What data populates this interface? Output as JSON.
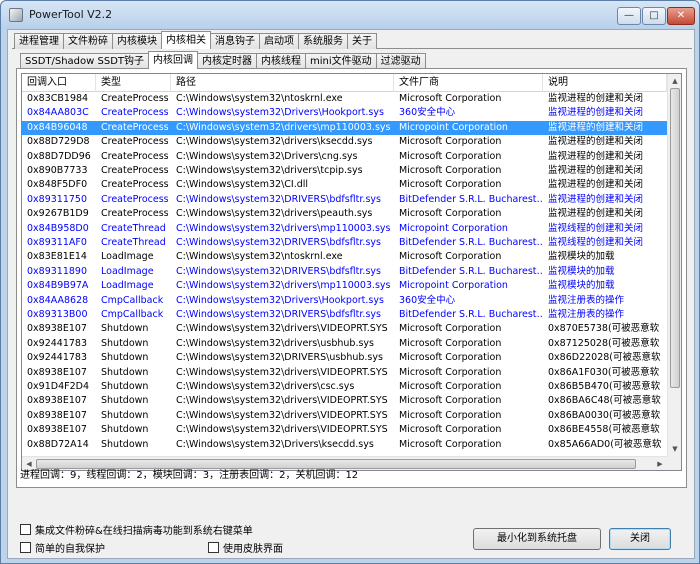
{
  "window": {
    "title": "PowerTool V2.2"
  },
  "tabs_top": [
    "进程管理",
    "文件粉碎",
    "内核模块",
    "内核相关",
    "消息钩子",
    "启动项",
    "系统服务",
    "关于"
  ],
  "tabs_top_active": 3,
  "tabs_sub": [
    "SSDT/Shadow SSDT钩子",
    "内核回调",
    "内核定时器",
    "内核线程",
    "mini文件驱动",
    "过滤驱动"
  ],
  "tabs_sub_active": 1,
  "columns": [
    "回调入口",
    "类型",
    "路径",
    "文件厂商",
    "说明"
  ],
  "rows": [
    {
      "entry": "0x83CB1984",
      "type": "CreateProcess",
      "path": "C:\\Windows\\system32\\ntoskrnl.exe",
      "vendor": "Microsoft Corporation",
      "desc": "监视进程的创建和关闭",
      "blue": false
    },
    {
      "entry": "0x84AA803C",
      "type": "CreateProcess",
      "path": "C:\\Windows\\system32\\Drivers\\Hookport.sys",
      "vendor": "360安全中心",
      "desc": "监视进程的创建和关闭",
      "blue": true
    },
    {
      "entry": "0x84B96048",
      "type": "CreateProcess",
      "path": "C:\\Windows\\system32\\drivers\\mp110003.sys",
      "vendor": "Micropoint Corporation",
      "desc": "监视进程的创建和关闭",
      "blue": true,
      "selected": true
    },
    {
      "entry": "0x88D729D8",
      "type": "CreateProcess",
      "path": "C:\\Windows\\system32\\drivers\\ksecdd.sys",
      "vendor": "Microsoft Corporation",
      "desc": "监视进程的创建和关闭",
      "blue": false
    },
    {
      "entry": "0x88D7DD96",
      "type": "CreateProcess",
      "path": "C:\\Windows\\system32\\Drivers\\cng.sys",
      "vendor": "Microsoft Corporation",
      "desc": "监视进程的创建和关闭",
      "blue": false
    },
    {
      "entry": "0x890B7733",
      "type": "CreateProcess",
      "path": "C:\\Windows\\system32\\drivers\\tcpip.sys",
      "vendor": "Microsoft Corporation",
      "desc": "监视进程的创建和关闭",
      "blue": false
    },
    {
      "entry": "0x848F5DF0",
      "type": "CreateProcess",
      "path": "C:\\Windows\\system32\\CI.dll",
      "vendor": "Microsoft Corporation",
      "desc": "监视进程的创建和关闭",
      "blue": false
    },
    {
      "entry": "0x89311750",
      "type": "CreateProcess",
      "path": "C:\\Windows\\system32\\DRIVERS\\bdfsfltr.sys",
      "vendor": "BitDefender S.R.L. Bucharest…",
      "desc": "监视进程的创建和关闭",
      "blue": true
    },
    {
      "entry": "0x9267B1D9",
      "type": "CreateProcess",
      "path": "C:\\Windows\\system32\\drivers\\peauth.sys",
      "vendor": "Microsoft Corporation",
      "desc": "监视进程的创建和关闭",
      "blue": false
    },
    {
      "entry": "0x84B958D0",
      "type": "CreateThread",
      "path": "C:\\Windows\\system32\\drivers\\mp110003.sys",
      "vendor": "Micropoint Corporation",
      "desc": "监视线程的创建和关闭",
      "blue": true
    },
    {
      "entry": "0x89311AF0",
      "type": "CreateThread",
      "path": "C:\\Windows\\system32\\DRIVERS\\bdfsfltr.sys",
      "vendor": "BitDefender S.R.L. Bucharest…",
      "desc": "监视线程的创建和关闭",
      "blue": true
    },
    {
      "entry": "0x83E81E14",
      "type": "LoadImage",
      "path": "C:\\Windows\\system32\\ntoskrnl.exe",
      "vendor": "Microsoft Corporation",
      "desc": "监视模块的加载",
      "blue": false
    },
    {
      "entry": "0x89311890",
      "type": "LoadImage",
      "path": "C:\\Windows\\system32\\DRIVERS\\bdfsfltr.sys",
      "vendor": "BitDefender S.R.L. Bucharest…",
      "desc": "监视模块的加载",
      "blue": true
    },
    {
      "entry": "0x84B9B97A",
      "type": "LoadImage",
      "path": "C:\\Windows\\system32\\drivers\\mp110003.sys",
      "vendor": "Micropoint Corporation",
      "desc": "监视模块的加载",
      "blue": true
    },
    {
      "entry": "0x84AA8628",
      "type": "CmpCallback",
      "path": "C:\\Windows\\system32\\Drivers\\Hookport.sys",
      "vendor": "360安全中心",
      "desc": "监视注册表的操作",
      "blue": true
    },
    {
      "entry": "0x89313B00",
      "type": "CmpCallback",
      "path": "C:\\Windows\\system32\\DRIVERS\\bdfsfltr.sys",
      "vendor": "BitDefender S.R.L. Bucharest…",
      "desc": "监视注册表的操作",
      "blue": true
    },
    {
      "entry": "0x8938E107",
      "type": "Shutdown",
      "path": "C:\\Windows\\system32\\drivers\\VIDEOPRT.SYS",
      "vendor": "Microsoft Corporation",
      "desc": "0x870E5738(可被恶意软",
      "blue": false
    },
    {
      "entry": "0x92441783",
      "type": "Shutdown",
      "path": "C:\\Windows\\system32\\drivers\\usbhub.sys",
      "vendor": "Microsoft Corporation",
      "desc": "0x87125028(可被恶意软",
      "blue": false
    },
    {
      "entry": "0x92441783",
      "type": "Shutdown",
      "path": "C:\\Windows\\system32\\DRIVERS\\usbhub.sys",
      "vendor": "Microsoft Corporation",
      "desc": "0x86D22028(可被恶意软",
      "blue": false
    },
    {
      "entry": "0x8938E107",
      "type": "Shutdown",
      "path": "C:\\Windows\\system32\\drivers\\VIDEOPRT.SYS",
      "vendor": "Microsoft Corporation",
      "desc": "0x86A1F030(可被恶意软",
      "blue": false
    },
    {
      "entry": "0x91D4F2D4",
      "type": "Shutdown",
      "path": "C:\\Windows\\system32\\drivers\\csc.sys",
      "vendor": "Microsoft Corporation",
      "desc": "0x86B5B470(可被恶意软",
      "blue": false
    },
    {
      "entry": "0x8938E107",
      "type": "Shutdown",
      "path": "C:\\Windows\\system32\\drivers\\VIDEOPRT.SYS",
      "vendor": "Microsoft Corporation",
      "desc": "0x86BA6C48(可被恶意软",
      "blue": false
    },
    {
      "entry": "0x8938E107",
      "type": "Shutdown",
      "path": "C:\\Windows\\system32\\drivers\\VIDEOPRT.SYS",
      "vendor": "Microsoft Corporation",
      "desc": "0x86BA0030(可被恶意软",
      "blue": false
    },
    {
      "entry": "0x8938E107",
      "type": "Shutdown",
      "path": "C:\\Windows\\system32\\drivers\\VIDEOPRT.SYS",
      "vendor": "Microsoft Corporation",
      "desc": "0x86BE4558(可被恶意软",
      "blue": false
    },
    {
      "entry": "0x88D72A14",
      "type": "Shutdown",
      "path": "C:\\Windows\\system32\\Drivers\\ksecdd.sys",
      "vendor": "Microsoft Corporation",
      "desc": "0x85A66AD0(可被恶意软",
      "blue": false
    }
  ],
  "status_text": "进程回调：9，线程回调：2，模块回调：3，注册表回调：2，关机回调：12",
  "options": {
    "integrate_label": "集成文件粉碎&在线扫描病毒功能到系统右键菜单",
    "selfprotect_label": "简单的自我保护",
    "skin_label": "使用皮肤界面"
  },
  "buttons": {
    "minimize_tray": "最小化到系统托盘",
    "close": "关闭"
  },
  "colors": {
    "selected_bg": "#3399ff",
    "link_blue": "#0000ff"
  }
}
